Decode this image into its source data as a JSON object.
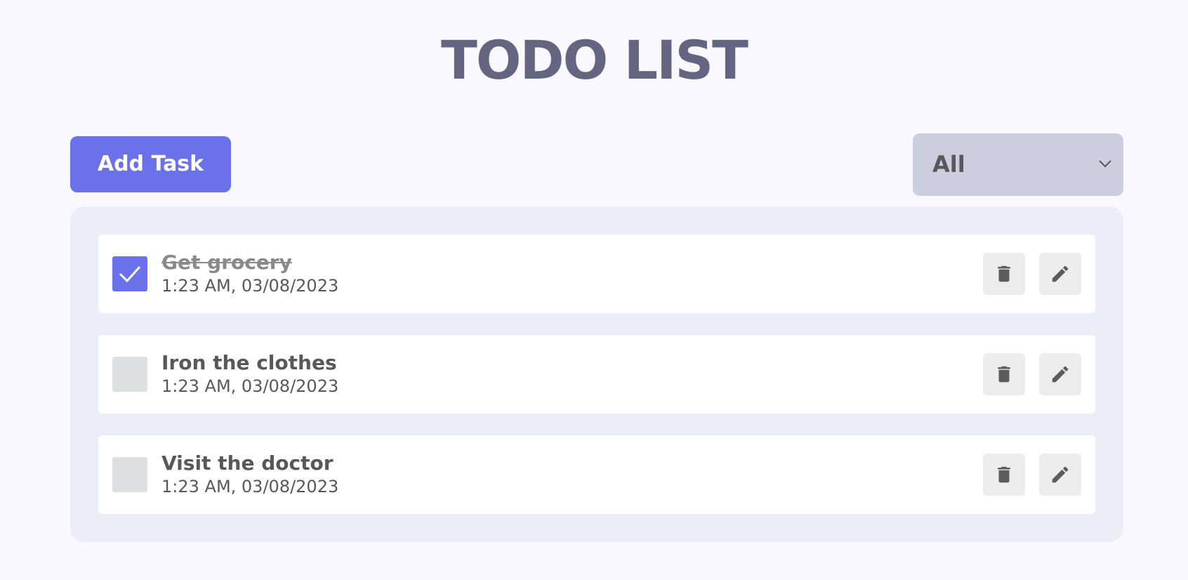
{
  "header": {
    "title": "TODO LIST"
  },
  "toolbar": {
    "add_label": "Add Task",
    "filter": {
      "selected": "All"
    }
  },
  "todos": [
    {
      "title": "Get grocery",
      "time": "1:23 AM, 03/08/2023",
      "completed": true
    },
    {
      "title": "Iron the clothes",
      "time": "1:23 AM, 03/08/2023",
      "completed": false
    },
    {
      "title": "Visit the doctor",
      "time": "1:23 AM, 03/08/2023",
      "completed": false
    }
  ],
  "colors": {
    "accent": "#6a71ea",
    "background": "#f8f8fe",
    "title": "#646681",
    "list_background": "#ecedf6",
    "filter_background": "#cccdde"
  },
  "icons": {
    "check": "check-icon",
    "delete": "trash-icon",
    "edit": "pencil-icon",
    "dropdown": "chevron-down-icon"
  }
}
